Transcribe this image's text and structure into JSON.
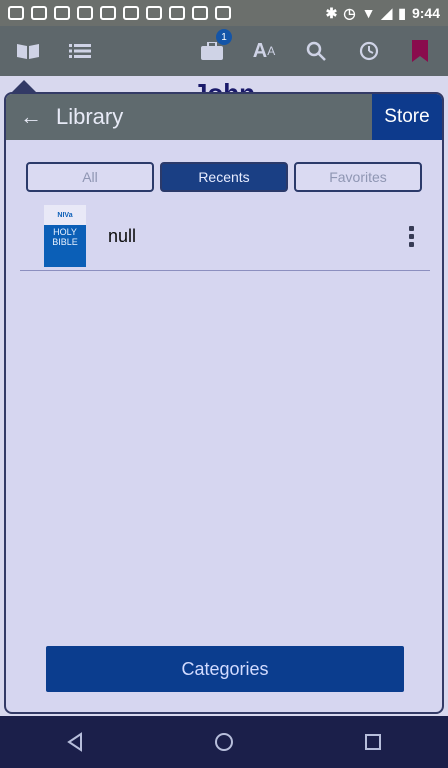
{
  "status_bar": {
    "time": "9:44",
    "icons": [
      "message-icon",
      "facebook-icon",
      "timer-icon",
      "wrench-icon",
      "face-icon",
      "facebook-icon",
      "qr-icon",
      "app-icon",
      "face-icon",
      "info-icon",
      "signal-off-icon",
      "bluetooth-icon",
      "alarm-icon",
      "wifi-icon",
      "signal-icon",
      "battery-icon"
    ]
  },
  "toolbar": {
    "badge_count": "1",
    "icons": [
      "book-icon",
      "list-icon",
      "briefcase-icon",
      "text-size-icon",
      "search-icon",
      "history-icon",
      "bookmark-icon"
    ]
  },
  "reader": {
    "chapter_title": "John"
  },
  "library": {
    "title": "Library",
    "store_label": "Store",
    "tabs": [
      {
        "label": "All",
        "active": false
      },
      {
        "label": "Recents",
        "active": true
      },
      {
        "label": "Favorites",
        "active": false
      }
    ],
    "items": [
      {
        "title": "null",
        "cover_top": "NIVa",
        "cover_text": "HOLY BIBLE"
      }
    ],
    "categories_label": "Categories"
  },
  "colors": {
    "accent": "#0b3d8e",
    "header": "#5f6a6e",
    "panel": "#d6d6f0"
  },
  "navbar": {
    "icons": [
      "back-icon",
      "home-icon",
      "recents-icon"
    ]
  }
}
